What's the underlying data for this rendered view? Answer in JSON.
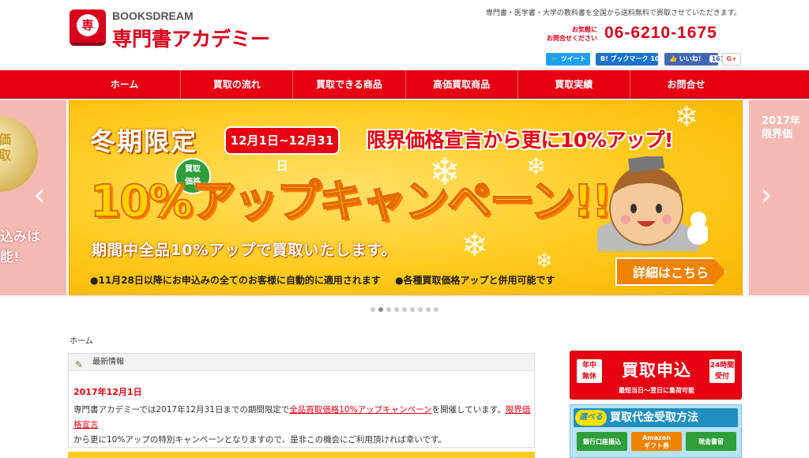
{
  "header": {
    "logo_seal": "専",
    "brand_small": "BOOKSDREAM",
    "site_name": "専門書アカデミー",
    "tagline": "専門書・医学書・大学の教科書を全国から送料無料で買取させていただきます。",
    "contact_label": "お気軽に\nお問合せください",
    "phone": "06-6210-1675",
    "share": {
      "tweet": "ツイート",
      "hatena": "B! ブックマーク 10",
      "facebook": "いいね！",
      "facebook_count": "161",
      "gplus": "G+"
    }
  },
  "nav": {
    "items": [
      {
        "label": "ホーム"
      },
      {
        "label": "買取の流れ"
      },
      {
        "label": "買取できる商品"
      },
      {
        "label": "高価買取商品"
      },
      {
        "label": "買取実績"
      },
      {
        "label": "お問合せ"
      }
    ]
  },
  "slider": {
    "left_medal": "価\n取",
    "left_side_text": "込みは\n能!",
    "right_side_text": "2017年\n限界価",
    "arrow_left": "‹",
    "arrow_right": "›",
    "main": {
      "winter_title": "冬期限定",
      "date_badge": "12月1日~12月31日",
      "limit_text": "限界価格宣言から更に10%アップ!",
      "kaitori_bubble": "買取\n価格",
      "campaign_big": "10%アップキャンペーン!!",
      "sub_copy": "期間中全品10%アップで買取いたします。",
      "bullet1": "●11月28日以降にお申込みの全てのお客様に自動的に適用されます",
      "bullet2": "●各種買取価格アップと併用可能です",
      "detail_button": "詳細はこちら"
    },
    "dot_count": 9,
    "active_dot": 1
  },
  "breadcrumb": "ホーム",
  "news": {
    "heading": "最新情報",
    "date": "2017年12月1日",
    "text_before": "専門書アカデミーでは2017年12月31日までの期間限定で",
    "link1": "全品買取価格10%アップキャンペーン",
    "text_mid": "を開催しています。",
    "link2": "限界価格宣言",
    "text_after": "から更に10%アップの特別キャンペーンとなりますので、是非この機会にご利用頂ければ幸いです。"
  },
  "sidebar": {
    "apply": {
      "tag_left": "年中\n無休",
      "main": "買取申込",
      "tag_right": "24時間\n受付",
      "sub": "最短当日～翌日に集荷可能"
    },
    "method": {
      "choose": "選べる",
      "title": "買取代金受取方法",
      "options": [
        "銀行口座振込",
        "Amazon\nギフト券",
        "現金書留"
      ]
    }
  },
  "colors": {
    "brand_red": "#e60012",
    "campaign_yellow": "#ffcb1f",
    "accent_orange": "#f08300"
  }
}
